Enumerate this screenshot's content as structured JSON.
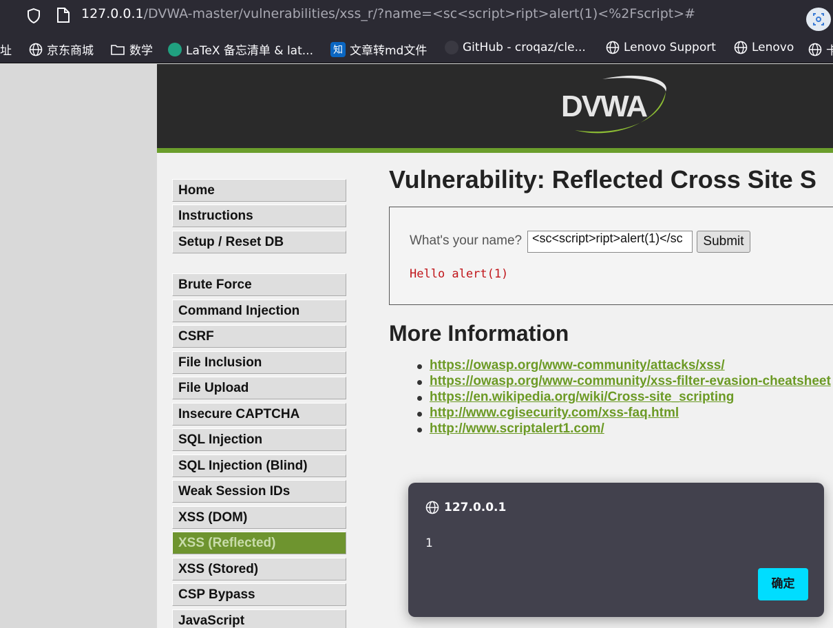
{
  "browser": {
    "url_host": "127.0.0.1",
    "url_path": "/DVWA-master/vulnerabilities/xss_r/?name=<sc<script>ript>alert(1)<%2Fscript>#",
    "bookmarks": [
      {
        "label": "址",
        "icon": "none"
      },
      {
        "label": "京东商城",
        "icon": "globe-icon"
      },
      {
        "label": "数学",
        "icon": "folder-icon"
      },
      {
        "label": "LaTeX 备忘清单 & lat...",
        "icon": "leaf-icon"
      },
      {
        "label": "文章转md文件",
        "icon": "zhihu-icon",
        "icon_text": "知"
      },
      {
        "label": "GitHub - croqaz/cle...",
        "icon": "github-icon"
      },
      {
        "label": "Lenovo Support",
        "icon": "globe-icon"
      },
      {
        "label": "Lenovo",
        "icon": "globe-icon"
      },
      {
        "label": "卡",
        "icon": "globe-icon"
      }
    ]
  },
  "header": {
    "logo_text": "DVWA"
  },
  "menu": {
    "items": [
      {
        "label": "Home",
        "active": false
      },
      {
        "label": "Instructions",
        "active": false
      },
      {
        "label": "Setup / Reset DB",
        "active": false
      },
      {
        "label": "Brute Force",
        "active": false
      },
      {
        "label": "Command Injection",
        "active": false
      },
      {
        "label": "CSRF",
        "active": false
      },
      {
        "label": "File Inclusion",
        "active": false
      },
      {
        "label": "File Upload",
        "active": false
      },
      {
        "label": "Insecure CAPTCHA",
        "active": false
      },
      {
        "label": "SQL Injection",
        "active": false
      },
      {
        "label": "SQL Injection (Blind)",
        "active": false
      },
      {
        "label": "Weak Session IDs",
        "active": false
      },
      {
        "label": "XSS (DOM)",
        "active": false
      },
      {
        "label": "XSS (Reflected)",
        "active": true
      },
      {
        "label": "XSS (Stored)",
        "active": false
      },
      {
        "label": "CSP Bypass",
        "active": false
      },
      {
        "label": "JavaScript",
        "active": false
      }
    ]
  },
  "main": {
    "title": "Vulnerability: Reflected Cross Site S",
    "question_label": "What's your name?",
    "name_value": "<sc<script>ript>alert(1)</sc",
    "submit_label": "Submit",
    "output": "Hello alert(1)",
    "more_info_heading": "More Information",
    "links": [
      "https://owasp.org/www-community/attacks/xss/",
      "https://owasp.org/www-community/xss-filter-evasion-cheatsheet",
      "https://en.wikipedia.org/wiki/Cross-site_scripting",
      "http://www.cgisecurity.com/xss-faq.html",
      "http://www.scriptalert1.com/"
    ]
  },
  "dialog": {
    "origin": "127.0.0.1",
    "message": "1",
    "ok_label": "确定"
  },
  "colors": {
    "accent_green": "#6b9e2c",
    "link_green": "#6c9a25",
    "output_red": "#c0151a",
    "dialog_button": "#00ddff"
  }
}
